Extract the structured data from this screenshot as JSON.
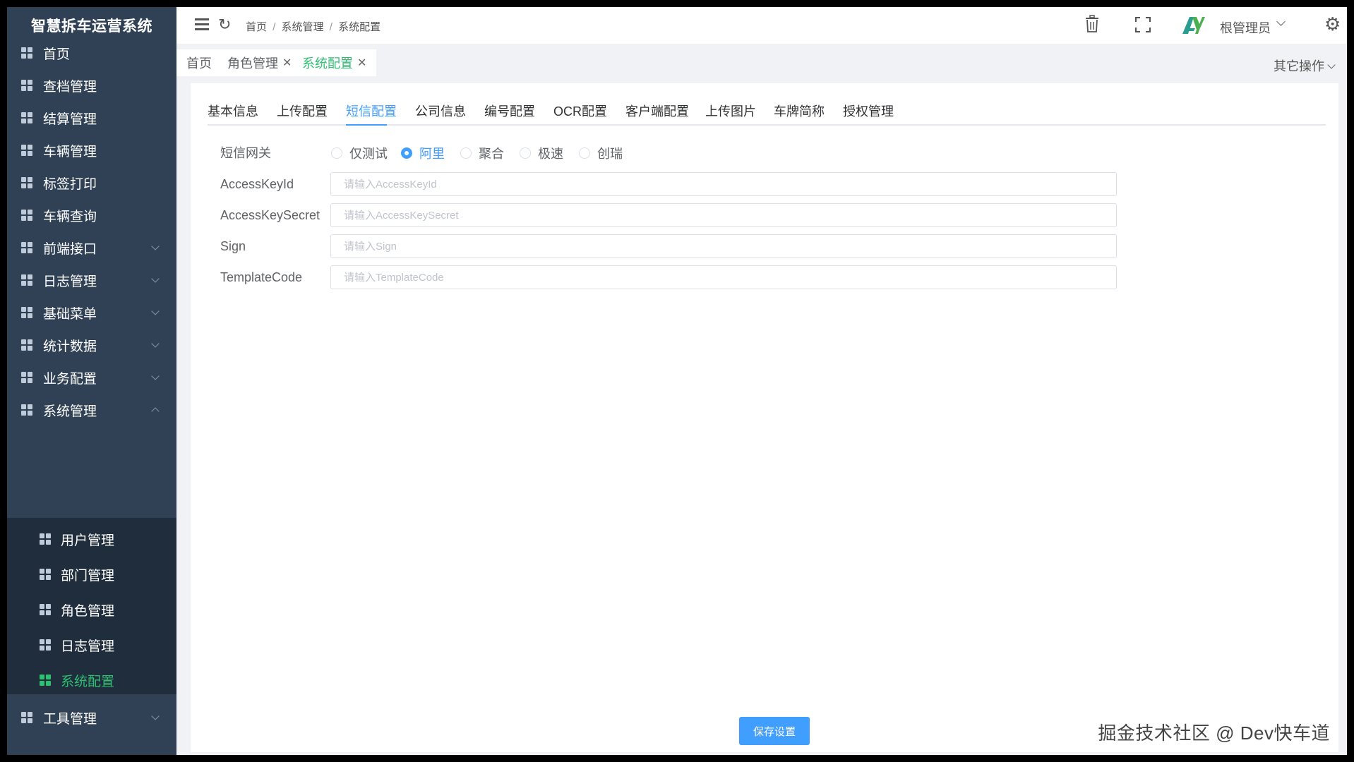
{
  "app": {
    "title": "智慧拆车运营系统"
  },
  "sidebar": {
    "items": [
      {
        "label": "首页",
        "icon": "grid-icon"
      },
      {
        "label": "查档管理",
        "icon": "grid-icon"
      },
      {
        "label": "结算管理",
        "icon": "grid-icon"
      },
      {
        "label": "车辆管理",
        "icon": "grid-icon"
      },
      {
        "label": "标签打印",
        "icon": "grid-icon"
      },
      {
        "label": "车辆查询",
        "icon": "grid-icon"
      },
      {
        "label": "前端接口",
        "icon": "grid-icon",
        "expandable": true
      },
      {
        "label": "日志管理",
        "icon": "grid-icon",
        "expandable": true
      },
      {
        "label": "基础菜单",
        "icon": "grid-icon",
        "expandable": true
      },
      {
        "label": "统计数据",
        "icon": "grid-icon",
        "expandable": true
      },
      {
        "label": "业务配置",
        "icon": "grid-icon",
        "expandable": true
      },
      {
        "label": "系统管理",
        "icon": "grid-icon",
        "expandable": true,
        "expanded": true
      },
      {
        "label": "工具管理",
        "icon": "grid-icon",
        "expandable": true
      }
    ],
    "sub_items": [
      {
        "label": "用户管理"
      },
      {
        "label": "部门管理"
      },
      {
        "label": "角色管理"
      },
      {
        "label": "日志管理"
      },
      {
        "label": "系统配置",
        "active": true
      }
    ]
  },
  "header": {
    "breadcrumb": [
      "首页",
      "系统管理",
      "系统配置"
    ],
    "username": "根管理员",
    "avatar_text": "AY"
  },
  "tags": {
    "items": [
      {
        "label": "首页",
        "closable": false
      },
      {
        "label": "角色管理",
        "closable": true
      },
      {
        "label": "系统配置",
        "closable": true,
        "active": true
      }
    ],
    "other_ops": "其它操作"
  },
  "tabs": {
    "items": [
      "基本信息",
      "上传配置",
      "短信配置",
      "公司信息",
      "编号配置",
      "OCR配置",
      "客户端配置",
      "上传图片",
      "车牌简称",
      "授权管理"
    ],
    "active_index": 2
  },
  "form": {
    "gateway": {
      "label": "短信网关",
      "options": [
        "仅测试",
        "阿里",
        "聚合",
        "极速",
        "创瑞"
      ],
      "selected": "阿里"
    },
    "fields": [
      {
        "label": "AccessKeyId",
        "placeholder": "请输入AccessKeyId",
        "value": ""
      },
      {
        "label": "AccessKeySecret",
        "placeholder": "请输入AccessKeySecret",
        "value": ""
      },
      {
        "label": "Sign",
        "placeholder": "请输入Sign",
        "value": ""
      },
      {
        "label": "TemplateCode",
        "placeholder": "请输入TemplateCode",
        "value": ""
      }
    ],
    "save_label": "保存设置"
  },
  "watermark": "掘金技术社区 @ Dev快车道",
  "colors": {
    "sidebar_bg": "#304156",
    "submenu_bg": "#1f2d3d",
    "active_green": "#2fbf71",
    "primary_blue": "#409eff"
  }
}
